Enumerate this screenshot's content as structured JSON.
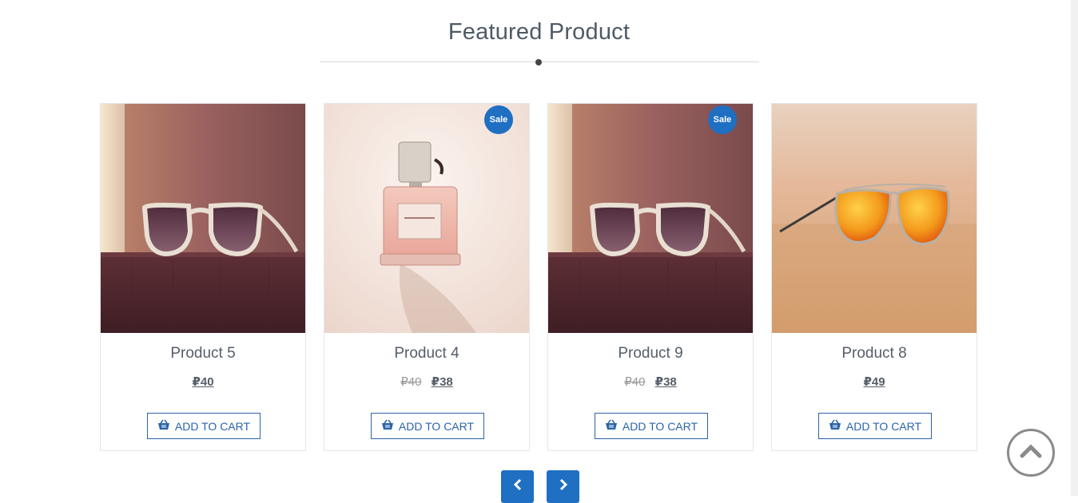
{
  "section": {
    "title": "Featured Product"
  },
  "products": [
    {
      "name": "Product 5",
      "price_old": "",
      "price": "₽40",
      "sale": false,
      "sale_label": "",
      "image": "sunglasses-on-table"
    },
    {
      "name": "Product 4",
      "price_old": "₽40",
      "price": "₽38",
      "sale": true,
      "sale_label": "Sale",
      "image": "perfume-bottle"
    },
    {
      "name": "Product 9",
      "price_old": "₽40",
      "price": "₽38",
      "sale": true,
      "sale_label": "Sale",
      "image": "sunglasses-on-table"
    },
    {
      "name": "Product 8",
      "price_old": "",
      "price": "₽49",
      "sale": false,
      "sale_label": "",
      "image": "aviator-sunglasses-on-sand"
    }
  ],
  "add_to_cart_label": "ADD TO CART",
  "icons": {
    "cart": "basket-icon",
    "prev": "chevron-left-icon",
    "next": "chevron-right-icon",
    "scroll_top": "chevron-up-icon"
  },
  "colors": {
    "accent": "#1f6fc3",
    "button_text": "#2a64a8",
    "title": "#4f5a66"
  }
}
